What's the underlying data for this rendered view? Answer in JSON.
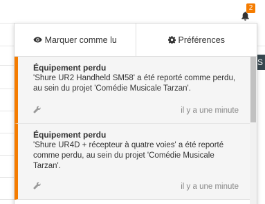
{
  "header": {
    "notifications_badge": "2",
    "bell_icon": "bell-icon",
    "badge_color": "#f57c00"
  },
  "background": {
    "tab_letter": "S"
  },
  "dropdown": {
    "actions": {
      "mark_read_label": "Marquer comme lu",
      "mark_read_icon": "eye-icon",
      "preferences_label": "Préférences",
      "preferences_icon": "gear-icon"
    },
    "accent_color": "#f57c00",
    "notifications": [
      {
        "title": "Équipement perdu",
        "body": "'Shure UR2 Handheld SM58' a été reporté comme perdu, au sein du projet 'Comédie Musicale Tarzan'.",
        "time": "il y a une minute",
        "icon": "wrench-icon"
      },
      {
        "title": "Équipement perdu",
        "body": "'Shure UR4D + récepteur à quatre voies' a été reporté comme perdu, au sein du projet 'Comédie Musicale Tarzan'.",
        "time": "il y a une minute",
        "icon": "wrench-icon"
      }
    ]
  }
}
